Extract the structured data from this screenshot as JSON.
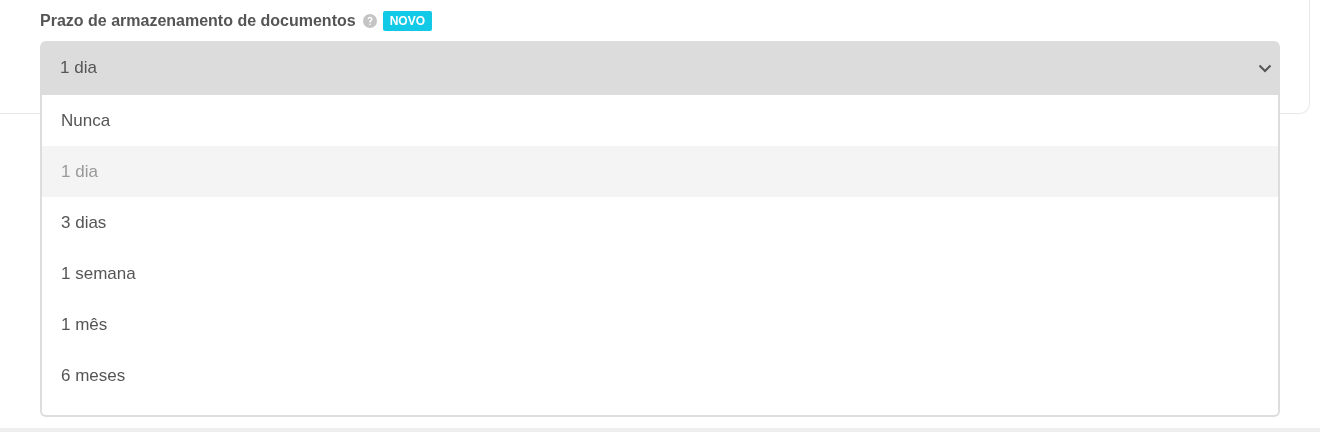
{
  "field": {
    "label": "Prazo de armazenamento de documentos",
    "badge": "NOVO",
    "value": "1 dia",
    "expanded": true
  },
  "options": [
    {
      "label": "Nunca",
      "selected": false
    },
    {
      "label": "1 dia",
      "selected": true
    },
    {
      "label": "3 dias",
      "selected": false
    },
    {
      "label": "1 semana",
      "selected": false
    },
    {
      "label": "1 mês",
      "selected": false
    },
    {
      "label": "6 meses",
      "selected": false
    }
  ]
}
